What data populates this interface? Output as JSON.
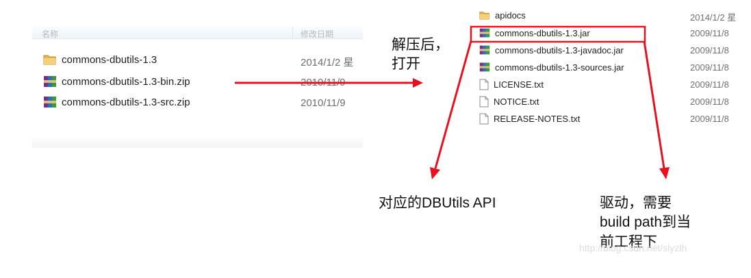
{
  "left_panel": {
    "header": {
      "name_col": "名称",
      "date_col": "修改日期"
    },
    "files": [
      {
        "name": "commons-dbutils-1.3",
        "date": "2014/1/2 星",
        "icon": "folder-icon"
      },
      {
        "name": "commons-dbutils-1.3-bin.zip",
        "date": "2010/11/9",
        "icon": "archive-icon"
      },
      {
        "name": "commons-dbutils-1.3-src.zip",
        "date": "2010/11/9",
        "icon": "archive-icon"
      }
    ]
  },
  "right_panel": {
    "files": [
      {
        "name": "apidocs",
        "date": "2014/1/2 星",
        "icon": "folder-icon"
      },
      {
        "name": "commons-dbutils-1.3.jar",
        "date": "2009/11/8",
        "icon": "archive-icon"
      },
      {
        "name": "commons-dbutils-1.3-javadoc.jar",
        "date": "2009/11/8",
        "icon": "archive-icon"
      },
      {
        "name": "commons-dbutils-1.3-sources.jar",
        "date": "2009/11/8",
        "icon": "archive-icon"
      },
      {
        "name": "LICENSE.txt",
        "date": "2009/11/8",
        "icon": "text-file-icon"
      },
      {
        "name": "NOTICE.txt",
        "date": "2009/11/8",
        "icon": "text-file-icon"
      },
      {
        "name": "RELEASE-NOTES.txt",
        "date": "2009/11/8",
        "icon": "text-file-icon"
      }
    ]
  },
  "annotations": {
    "unzip_open": "解压后，\n打开",
    "api_docs": "对应的DBUtils API",
    "driver_build_path": "驱动，需要\nbuild path到当\n前工程下"
  },
  "watermark": "http://blog.csdn.net/slyzlh",
  "colors": {
    "arrow": "#e8101e",
    "highlight_box": "#e8101e",
    "folder": "#e7b84b",
    "archive": "#7a2d8c"
  }
}
